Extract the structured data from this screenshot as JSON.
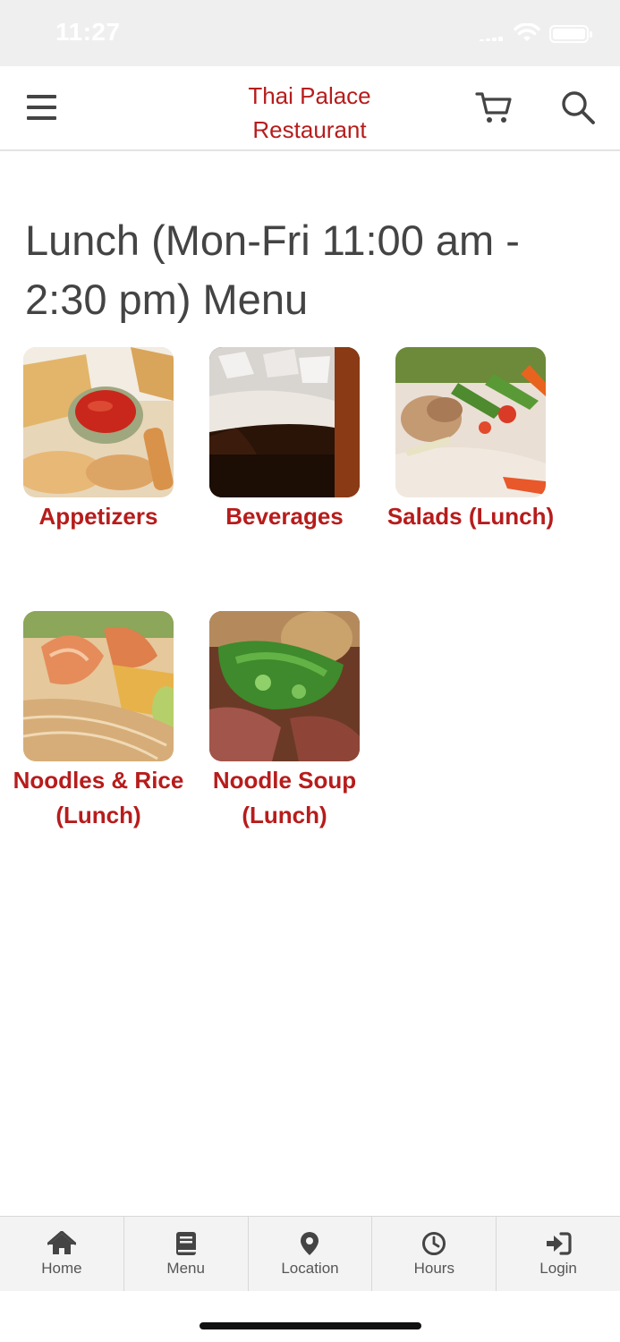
{
  "status_bar": {
    "time": "11:27"
  },
  "header": {
    "brand_line1": "Thai Palace",
    "brand_line2": "Restaurant"
  },
  "page_title": "Lunch (Mon-Fri 11:00 am - 2:30 pm) Menu",
  "categories": [
    {
      "label": "Appetizers",
      "image": "appetizers-photo"
    },
    {
      "label": "Beverages",
      "image": "beverages-photo"
    },
    {
      "label": "Salads (Lunch)",
      "image": "salads-photo"
    },
    {
      "label": "Noodles & Rice (Lunch)",
      "image": "noodles-rice-photo"
    },
    {
      "label": "Noodle Soup (Lunch)",
      "image": "noodle-soup-photo"
    }
  ],
  "bottom_nav": [
    {
      "label": "Home",
      "icon": "home-icon"
    },
    {
      "label": "Menu",
      "icon": "book-icon"
    },
    {
      "label": "Location",
      "icon": "map-pin-icon"
    },
    {
      "label": "Hours",
      "icon": "clock-icon"
    },
    {
      "label": "Login",
      "icon": "sign-in-icon"
    }
  ],
  "colors": {
    "accent": "#b71c1c",
    "text": "#444444",
    "nav_bg": "#f3f3f3"
  }
}
